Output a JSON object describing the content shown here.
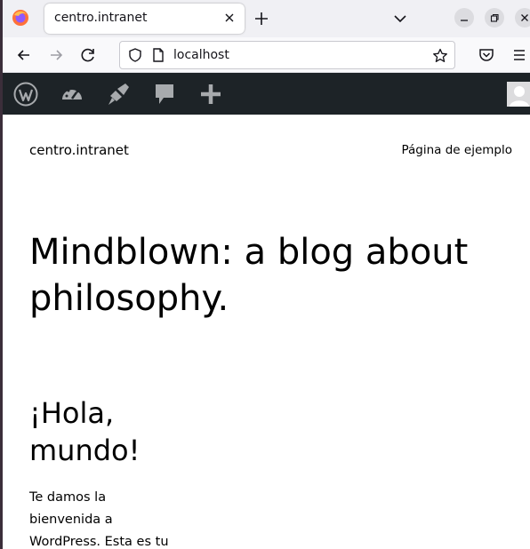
{
  "browser": {
    "tab": {
      "title": "centro.intranet"
    },
    "address": {
      "url": "localhost"
    }
  },
  "admin_bar": {
    "icons": [
      "wordpress-icon",
      "customize-icon",
      "brush-icon",
      "comments-icon",
      "new-content-icon",
      "avatar"
    ]
  },
  "site": {
    "title": "centro.intranet",
    "nav_link": "Página de ejemplo",
    "tagline": "Mindblown: a blog about philosophy."
  },
  "post": {
    "title": "¡Hola, mundo!",
    "excerpt": "Te damos la bienvenida a WordPress. Esta es tu"
  },
  "colors": {
    "admin_bar_bg": "#1d2327",
    "tabbar_bg": "#f0f0f4",
    "page_bg": "#ffffff"
  }
}
